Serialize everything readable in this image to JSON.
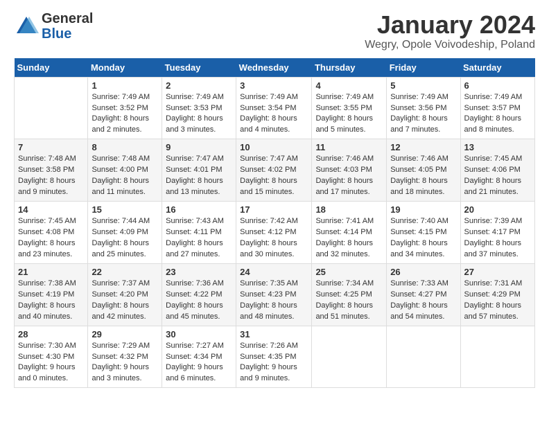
{
  "header": {
    "logo_general": "General",
    "logo_blue": "Blue",
    "month_title": "January 2024",
    "location": "Wegry, Opole Voivodeship, Poland"
  },
  "weekdays": [
    "Sunday",
    "Monday",
    "Tuesday",
    "Wednesday",
    "Thursday",
    "Friday",
    "Saturday"
  ],
  "weeks": [
    [
      {
        "day": "",
        "info": ""
      },
      {
        "day": "1",
        "info": "Sunrise: 7:49 AM\nSunset: 3:52 PM\nDaylight: 8 hours\nand 2 minutes."
      },
      {
        "day": "2",
        "info": "Sunrise: 7:49 AM\nSunset: 3:53 PM\nDaylight: 8 hours\nand 3 minutes."
      },
      {
        "day": "3",
        "info": "Sunrise: 7:49 AM\nSunset: 3:54 PM\nDaylight: 8 hours\nand 4 minutes."
      },
      {
        "day": "4",
        "info": "Sunrise: 7:49 AM\nSunset: 3:55 PM\nDaylight: 8 hours\nand 5 minutes."
      },
      {
        "day": "5",
        "info": "Sunrise: 7:49 AM\nSunset: 3:56 PM\nDaylight: 8 hours\nand 7 minutes."
      },
      {
        "day": "6",
        "info": "Sunrise: 7:49 AM\nSunset: 3:57 PM\nDaylight: 8 hours\nand 8 minutes."
      }
    ],
    [
      {
        "day": "7",
        "info": "Sunrise: 7:48 AM\nSunset: 3:58 PM\nDaylight: 8 hours\nand 9 minutes."
      },
      {
        "day": "8",
        "info": "Sunrise: 7:48 AM\nSunset: 4:00 PM\nDaylight: 8 hours\nand 11 minutes."
      },
      {
        "day": "9",
        "info": "Sunrise: 7:47 AM\nSunset: 4:01 PM\nDaylight: 8 hours\nand 13 minutes."
      },
      {
        "day": "10",
        "info": "Sunrise: 7:47 AM\nSunset: 4:02 PM\nDaylight: 8 hours\nand 15 minutes."
      },
      {
        "day": "11",
        "info": "Sunrise: 7:46 AM\nSunset: 4:03 PM\nDaylight: 8 hours\nand 17 minutes."
      },
      {
        "day": "12",
        "info": "Sunrise: 7:46 AM\nSunset: 4:05 PM\nDaylight: 8 hours\nand 18 minutes."
      },
      {
        "day": "13",
        "info": "Sunrise: 7:45 AM\nSunset: 4:06 PM\nDaylight: 8 hours\nand 21 minutes."
      }
    ],
    [
      {
        "day": "14",
        "info": "Sunrise: 7:45 AM\nSunset: 4:08 PM\nDaylight: 8 hours\nand 23 minutes."
      },
      {
        "day": "15",
        "info": "Sunrise: 7:44 AM\nSunset: 4:09 PM\nDaylight: 8 hours\nand 25 minutes."
      },
      {
        "day": "16",
        "info": "Sunrise: 7:43 AM\nSunset: 4:11 PM\nDaylight: 8 hours\nand 27 minutes."
      },
      {
        "day": "17",
        "info": "Sunrise: 7:42 AM\nSunset: 4:12 PM\nDaylight: 8 hours\nand 30 minutes."
      },
      {
        "day": "18",
        "info": "Sunrise: 7:41 AM\nSunset: 4:14 PM\nDaylight: 8 hours\nand 32 minutes."
      },
      {
        "day": "19",
        "info": "Sunrise: 7:40 AM\nSunset: 4:15 PM\nDaylight: 8 hours\nand 34 minutes."
      },
      {
        "day": "20",
        "info": "Sunrise: 7:39 AM\nSunset: 4:17 PM\nDaylight: 8 hours\nand 37 minutes."
      }
    ],
    [
      {
        "day": "21",
        "info": "Sunrise: 7:38 AM\nSunset: 4:19 PM\nDaylight: 8 hours\nand 40 minutes."
      },
      {
        "day": "22",
        "info": "Sunrise: 7:37 AM\nSunset: 4:20 PM\nDaylight: 8 hours\nand 42 minutes."
      },
      {
        "day": "23",
        "info": "Sunrise: 7:36 AM\nSunset: 4:22 PM\nDaylight: 8 hours\nand 45 minutes."
      },
      {
        "day": "24",
        "info": "Sunrise: 7:35 AM\nSunset: 4:23 PM\nDaylight: 8 hours\nand 48 minutes."
      },
      {
        "day": "25",
        "info": "Sunrise: 7:34 AM\nSunset: 4:25 PM\nDaylight: 8 hours\nand 51 minutes."
      },
      {
        "day": "26",
        "info": "Sunrise: 7:33 AM\nSunset: 4:27 PM\nDaylight: 8 hours\nand 54 minutes."
      },
      {
        "day": "27",
        "info": "Sunrise: 7:31 AM\nSunset: 4:29 PM\nDaylight: 8 hours\nand 57 minutes."
      }
    ],
    [
      {
        "day": "28",
        "info": "Sunrise: 7:30 AM\nSunset: 4:30 PM\nDaylight: 9 hours\nand 0 minutes."
      },
      {
        "day": "29",
        "info": "Sunrise: 7:29 AM\nSunset: 4:32 PM\nDaylight: 9 hours\nand 3 minutes."
      },
      {
        "day": "30",
        "info": "Sunrise: 7:27 AM\nSunset: 4:34 PM\nDaylight: 9 hours\nand 6 minutes."
      },
      {
        "day": "31",
        "info": "Sunrise: 7:26 AM\nSunset: 4:35 PM\nDaylight: 9 hours\nand 9 minutes."
      },
      {
        "day": "",
        "info": ""
      },
      {
        "day": "",
        "info": ""
      },
      {
        "day": "",
        "info": ""
      }
    ]
  ]
}
